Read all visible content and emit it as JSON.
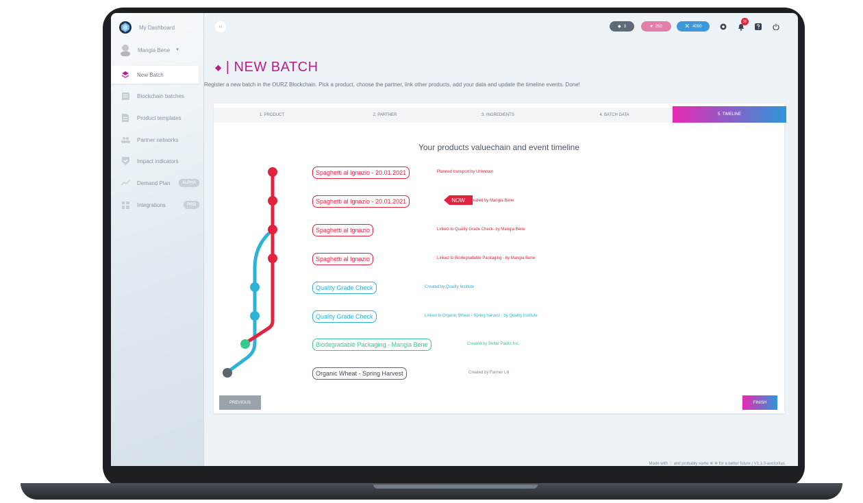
{
  "sidebar": {
    "items": [
      {
        "label": "My Dashboard",
        "icon": "logo-icon"
      },
      {
        "label": "Mangia Bene",
        "icon": "avatar"
      },
      {
        "label": "New Batch",
        "icon": "layers-icon"
      },
      {
        "label": "Blockchain batches",
        "icon": "blockchain-icon"
      },
      {
        "label": "Product templates",
        "icon": "document-icon"
      },
      {
        "label": "Partner networks",
        "icon": "people-icon"
      },
      {
        "label": "Impact indicators",
        "icon": "shield-check-icon"
      },
      {
        "label": "Demand Plan",
        "icon": "trend-line-icon",
        "badge": "ALPHA"
      },
      {
        "label": "Integrations",
        "icon": "grid-icon",
        "badge": "PRO"
      }
    ]
  },
  "topbar": {
    "collapse_label": "‹‹",
    "stats": [
      {
        "value": "3",
        "icon": "layers-icon",
        "color": "#5f6b78"
      },
      {
        "value": "250",
        "icon": "heart-icon",
        "color": "#e17fa8"
      },
      {
        "value": "4050",
        "icon": "x-icon",
        "color": "#3e97d9"
      }
    ],
    "notification_count": "36"
  },
  "page": {
    "icon": "layers-icon",
    "title": "| NEW BATCH",
    "subtitle": "Register a new batch in the OURZ Blockchain. Pick a product, choose the partner, link other products, add your data and update the timeline events. Done!"
  },
  "wizard": {
    "tabs": [
      "1. PRODUCT",
      "2. PARTNER",
      "3. INGREDIENTS",
      "4. BATCH DATA",
      "5. TIMELINE"
    ],
    "active_tab": 4,
    "heading": "Your products valuechain and event timeline",
    "events": [
      {
        "label": "Spaghetti al Ignazio - 20.01.2021",
        "desc": "Planned transport by Unknown",
        "color": "#e2233d"
      },
      {
        "label": "Spaghetti al Ignazio - 20.01.2021",
        "desc": "Created by Mangia Bene",
        "color": "#e2233d",
        "tag": "NOW"
      },
      {
        "label": "Spaghetti al Ignazio",
        "desc": "Linked to Quality Grade Check- by Mangia Bene",
        "color": "#e2233d"
      },
      {
        "label": "Spaghetti al Ignazio",
        "desc": "Linked to Biodegradable Packaging - by Mangia Bene",
        "color": "#e2233d"
      },
      {
        "label": "Quality Grade Check",
        "desc": "Created by Quality Institute",
        "color": "#2db2d8"
      },
      {
        "label": "Quality Grade Check",
        "desc": "Linked to Organic Wheat - Spring harvest - by Quality Institute",
        "color": "#2db2d8"
      },
      {
        "label": "Biodegradable Packaging - Mangia Bene",
        "desc": "Created by Better Packs Inc.",
        "color": "#37c890"
      },
      {
        "label": "Organic Wheat - Spring Harvest",
        "desc": "Created by Farmer Lili",
        "color": "#596571"
      }
    ],
    "prev_label": "PREVIOUS",
    "finish_label": "FINISH"
  },
  "footer": {
    "text_a": "Made with ",
    "text_b": " and probably some ",
    "text_c": " for a better future | V1.1.0-auctoritas"
  }
}
